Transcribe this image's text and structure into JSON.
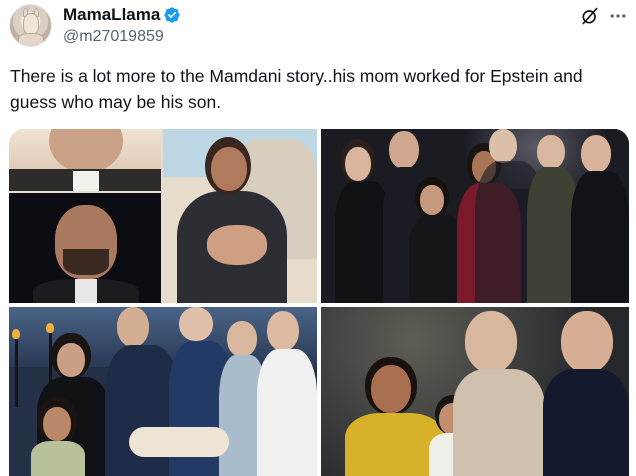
{
  "author": {
    "display_name": "MamaLlama",
    "handle": "@m27019859",
    "verified": true,
    "verified_color": "#1d9bf0"
  },
  "actions": {
    "grok_icon": "grok-slashed-circle-icon",
    "more_icon": "more-dots-icon"
  },
  "post": {
    "text": "There is a lot more to the Mamdani story..his mom worked for Epstein and guess who may be his son."
  },
  "media": {
    "photo_count": 4
  },
  "colors": {
    "text_primary": "#0f1419",
    "text_secondary": "#536471"
  }
}
